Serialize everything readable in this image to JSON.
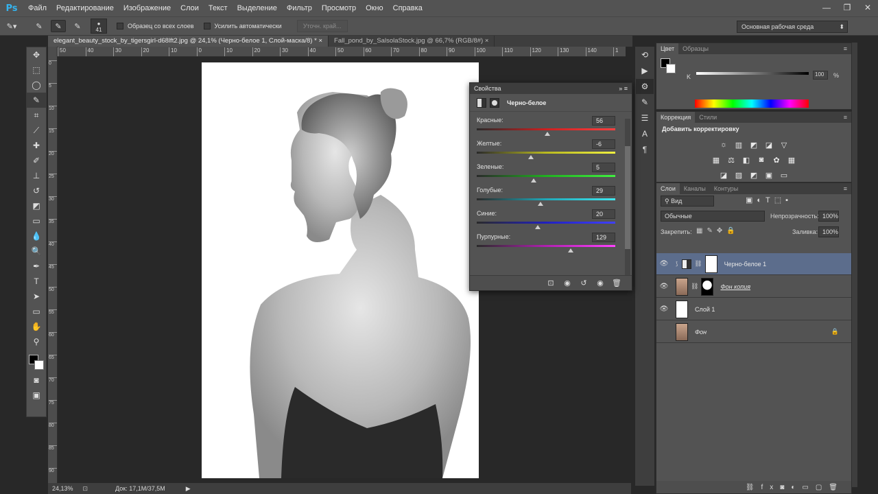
{
  "app": {
    "logo": "Ps"
  },
  "menu": [
    "Файл",
    "Редактирование",
    "Изображение",
    "Слои",
    "Текст",
    "Выделение",
    "Фильтр",
    "Просмотр",
    "Окно",
    "Справка"
  ],
  "window_controls": [
    "—",
    "❐",
    "✕"
  ],
  "options": {
    "brush_size": "41",
    "sample_all_layers": "Образец со всех слоев",
    "auto_enhance": "Усилить автоматически",
    "refine_edge": "Уточн. край...",
    "workspace": "Основная рабочая среда"
  },
  "tabs": [
    {
      "label": "elegant_beauty_stock_by_tigersgirl-d68lft2.jpg @ 24,1% (Черно-белое 1, Слой-маска/8) *",
      "close": "×"
    },
    {
      "label": "Fall_pond_by_SalsolaStock.jpg @ 66,7% (RGB/8#)",
      "close": "×"
    }
  ],
  "ruler_h": [
    "50",
    "40",
    "30",
    "20",
    "10",
    "0",
    "10",
    "20",
    "30",
    "40",
    "50",
    "60",
    "70",
    "80",
    "90",
    "100",
    "110",
    "120",
    "130",
    "140",
    "1"
  ],
  "ruler_v": [
    "0",
    "5",
    "10",
    "15",
    "20",
    "25",
    "30",
    "35",
    "40",
    "45",
    "50",
    "55",
    "60",
    "65",
    "70",
    "75",
    "80",
    "85",
    "90"
  ],
  "status": {
    "zoom": "24,13%",
    "doc": "Док: 17,1M/37,5M"
  },
  "properties": {
    "title": "Свойства",
    "subtitle": "Черно-белое",
    "sliders": [
      {
        "label": "Красные:",
        "value": "56",
        "pos": 0.51,
        "gradient": "#2a2a2a,#cc2020,#ff4040"
      },
      {
        "label": "Желтые:",
        "value": "-6",
        "pos": 0.39,
        "gradient": "#2a2a2a,#b9b920,#f0f040"
      },
      {
        "label": "Зеленые:",
        "value": "5",
        "pos": 0.41,
        "gradient": "#2a2a2a,#20b020,#40f040"
      },
      {
        "label": "Голубые:",
        "value": "29",
        "pos": 0.46,
        "gradient": "#2a2a2a,#20a8b8,#40e8f0"
      },
      {
        "label": "Синие:",
        "value": "20",
        "pos": 0.44,
        "gradient": "#2a2a2a,#2020c0,#4040ff"
      },
      {
        "label": "Пурпурные:",
        "value": "129",
        "pos": 0.68,
        "gradient": "#2a2a2a,#b020b0,#ff40ff"
      }
    ]
  },
  "color_panel": {
    "tabs": [
      "Цвет",
      "Образцы"
    ],
    "k_label": "K",
    "k_value": "100",
    "pct": "%"
  },
  "adjustments": {
    "tabs": [
      "Коррекция",
      "Стили"
    ],
    "title": "Добавить корректировку"
  },
  "layers_panel": {
    "tabs": [
      "Слои",
      "Каналы",
      "Контуры"
    ],
    "filter": "Вид",
    "blend": "Обычные",
    "opacity_label": "Непрозрачность:",
    "opacity": "100%",
    "lock_label": "Закрепить:",
    "fill_label": "Заливка:",
    "fill": "100%",
    "layers": [
      {
        "name": "Черно-белое 1",
        "selected": true
      },
      {
        "name": "Фон копия",
        "selected": false
      },
      {
        "name": "Слой 1",
        "selected": false
      },
      {
        "name": "Фон",
        "selected": false
      }
    ]
  }
}
